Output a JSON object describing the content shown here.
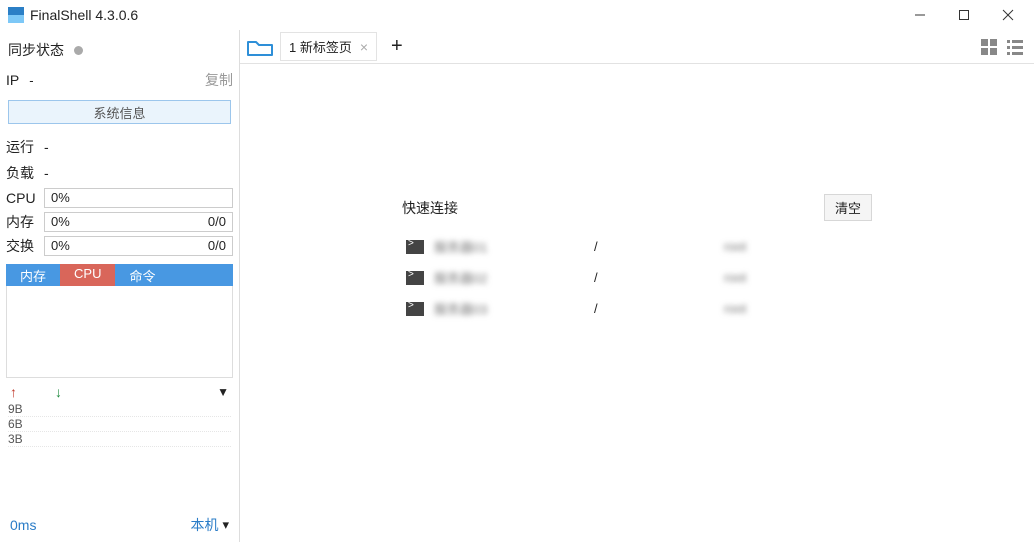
{
  "window": {
    "title": "FinalShell 4.3.0.6"
  },
  "sidebar": {
    "sync_label": "同步状态",
    "ip_label": "IP",
    "ip_value": "-",
    "copy": "复制",
    "sysinfo_btn": "系统信息",
    "run_label": "运行",
    "run_value": "-",
    "load_label": "负载",
    "load_value": "-",
    "cpu_label": "CPU",
    "cpu_pct": "0%",
    "mem_label": "内存",
    "mem_pct": "0%",
    "mem_ratio": "0/0",
    "swap_label": "交换",
    "swap_pct": "0%",
    "swap_ratio": "0/0",
    "tabs": [
      "内存",
      "CPU",
      "命令"
    ],
    "yticks": [
      "9B",
      "6B",
      "3B"
    ],
    "ms": "0ms",
    "local": "本机"
  },
  "topbar": {
    "tab_label": "1 新标签页"
  },
  "panel": {
    "title": "快速连接",
    "clear": "清空",
    "rows": [
      {
        "name": "服务器01",
        "path": "/",
        "user": "root"
      },
      {
        "name": "服务器02",
        "path": "/",
        "user": "root"
      },
      {
        "name": "服务器03",
        "path": "/",
        "user": "root"
      }
    ]
  }
}
